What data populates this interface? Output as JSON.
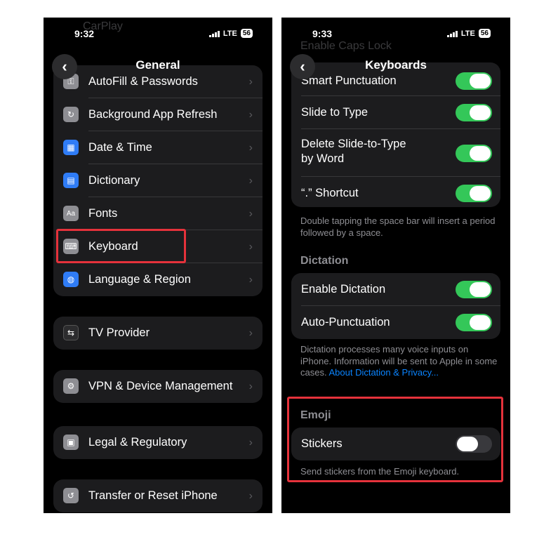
{
  "left": {
    "status": {
      "time": "9:32",
      "network": "LTE",
      "battery": "56"
    },
    "ghost_text": "CarPlay",
    "nav": {
      "title": "General",
      "back_icon": "chevron-left-icon"
    },
    "group1": [
      {
        "label": "AutoFill & Passwords",
        "icon": "key-icon",
        "color": "#8e8e93"
      },
      {
        "label": "Background App Refresh",
        "icon": "refresh-icon",
        "color": "#8e8e93"
      },
      {
        "label": "Date & Time",
        "icon": "calendar-icon",
        "color": "#2f7cf6"
      },
      {
        "label": "Dictionary",
        "icon": "book-icon",
        "color": "#2f7cf6"
      },
      {
        "label": "Fonts",
        "icon": "fonts-icon",
        "color": "#8e8e93"
      },
      {
        "label": "Keyboard",
        "icon": "keyboard-icon",
        "color": "#8e8e93"
      },
      {
        "label": "Language & Region",
        "icon": "globe-icon",
        "color": "#2f7cf6"
      }
    ],
    "tv_provider": {
      "label": "TV Provider",
      "icon": "tv-provider-icon"
    },
    "vpn": {
      "label": "VPN & Device Management",
      "icon": "gear-icon"
    },
    "legal": {
      "label": "Legal & Regulatory",
      "icon": "document-icon"
    },
    "transfer": {
      "label": "Transfer or Reset iPhone",
      "icon": "reset-icon"
    }
  },
  "right": {
    "status": {
      "time": "9:33",
      "network": "LTE",
      "battery": "56"
    },
    "ghost_text": "Enable Caps Lock",
    "nav": {
      "title": "Keyboards",
      "back_icon": "chevron-left-icon"
    },
    "group1": [
      {
        "label": "Smart Punctuation",
        "on": true
      },
      {
        "label": "Slide to Type",
        "on": true
      },
      {
        "label": "Delete Slide-to-Type\nby Word",
        "on": true
      },
      {
        "label": "“.” Shortcut",
        "on": true
      }
    ],
    "shortcut_footnote": "Double tapping the space bar will insert a period followed by a space.",
    "dictation_header": "Dictation",
    "dictation_rows": [
      {
        "label": "Enable Dictation",
        "on": true
      },
      {
        "label": "Auto-Punctuation",
        "on": true
      }
    ],
    "dictation_footnote": "Dictation processes many voice inputs on iPhone. Information will be sent to Apple in some cases.",
    "dictation_link": "About Dictation & Privacy...",
    "emoji_header": "Emoji",
    "stickers": {
      "label": "Stickers",
      "on": false
    },
    "stickers_footnote": "Send stickers from the Emoji keyboard."
  },
  "colors": {
    "toggle_on": "#34c759",
    "highlight": "#e5323b",
    "link": "#0a84ff"
  }
}
